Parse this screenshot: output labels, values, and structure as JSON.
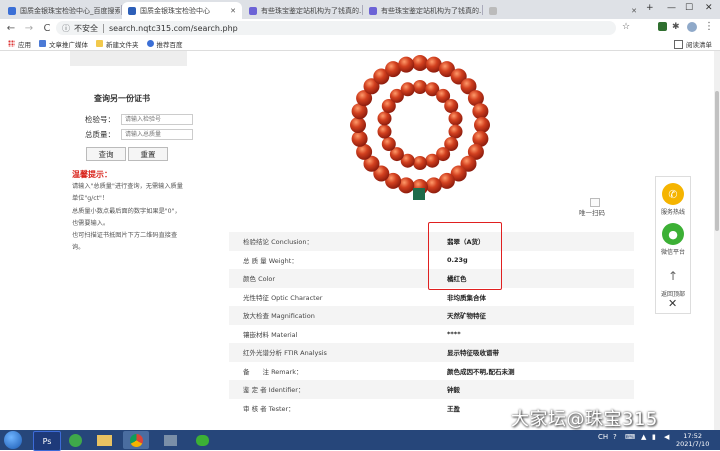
{
  "browser": {
    "tabs": [
      {
        "label": "国质金银珠宝检验中心_百度搜索",
        "active": false
      },
      {
        "label": "国质金银珠宝检验中心",
        "active": true
      },
      {
        "label": "有些珠宝鉴定站机构为了钱真的...",
        "active": false
      },
      {
        "label": "有些珠宝鉴定站机构为了钱真的...",
        "active": false
      }
    ],
    "nav": {
      "back": "←",
      "forward": "→",
      "reload": "C"
    },
    "security_label": "不安全",
    "url": "search.nqtc315.com/search.php",
    "bookmarks": [
      {
        "label": "应用",
        "icon": "apps-grid-icon"
      },
      {
        "label": "文章推广媒体",
        "icon": "bookmark-icon"
      },
      {
        "label": "新建文件夹",
        "icon": "folder-icon"
      },
      {
        "label": "推荐百度",
        "icon": "baidu-icon"
      }
    ],
    "reading_list": "阅读清单"
  },
  "lookup": {
    "title": "查询另一份证书",
    "cert_label": "检验号：",
    "cert_placeholder": "请输入检验号",
    "weight_label": "总质量：",
    "weight_placeholder": "请输入总质量",
    "query_button": "查询",
    "reset_button": "重置"
  },
  "tips": {
    "title": "温馨提示：",
    "lines": [
      "请输入\"总质量\"进行查询，无需输入质量",
      "单位\"g/ct\"！",
      "总质量小数点最后面的数字如果是\"0\"，",
      "也需要输入。",
      "也可扫描证书抵图片下方二维码直接查",
      "询。"
    ]
  },
  "scan_label": "唯一扫码",
  "report_rows": [
    {
      "key": "检验结论 Conclusion：",
      "value": "翡翠（A货）"
    },
    {
      "key": "总 质 量 Weight：",
      "value": "0.23g"
    },
    {
      "key": "颜色 Color",
      "value": "橘红色"
    },
    {
      "key": "光性特征 Optic Character",
      "value": "非均质集合体"
    },
    {
      "key": "放大检查 Magnification",
      "value": "天然矿物特征"
    },
    {
      "key": "镶嵌材料 Material",
      "value": "****"
    },
    {
      "key": "红外光谱分析 FTIR Analysis",
      "value": "显示特征吸收谱带"
    },
    {
      "key": "备　　注 Remark：",
      "value": "颜色成因不明,配石未测"
    },
    {
      "key": "鉴 定 者 Identifier：",
      "value": "钟毅"
    },
    {
      "key": "审 核 者 Tester：",
      "value": "王盈"
    }
  ],
  "sidebar": {
    "hotline": "服务热线",
    "wechat": "微信平台",
    "top": "返回顶部",
    "close": "✕"
  },
  "taskbar": {
    "lang": "CH",
    "time": "17:52",
    "date": "2021/7/10"
  },
  "watermark": "大家坛@珠宝315",
  "colors": {
    "accent_red": "#d9251d",
    "bead_red": "#c8321a",
    "hotline_yellow": "#f5b400",
    "wechat_green": "#3cb035",
    "taskbar": "#26467a"
  }
}
